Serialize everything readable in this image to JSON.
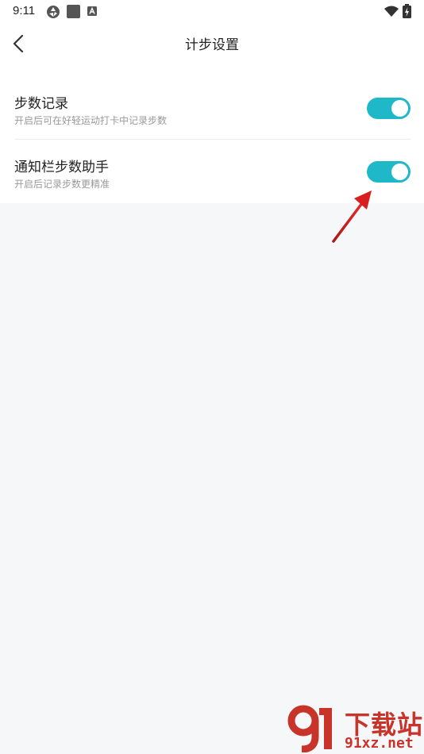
{
  "status_bar": {
    "time": "9:11",
    "icons": [
      "aperture-icon",
      "square-icon",
      "a-box-icon",
      "wifi-icon",
      "battery-charging-icon"
    ]
  },
  "header": {
    "title": "计步设置",
    "back_icon": "chevron-left-icon"
  },
  "settings": [
    {
      "title": "步数记录",
      "subtitle": "开启后可在好轻运动打卡中记录步数",
      "enabled": true
    },
    {
      "title": "通知栏步数助手",
      "subtitle": "开启后记录步数更精准",
      "enabled": true
    }
  ],
  "accent_color": "#1fb8c8",
  "annotation_color": "#d81f1f",
  "watermark": {
    "number": "91",
    "text": "下载站",
    "domain": "91xz.net"
  }
}
